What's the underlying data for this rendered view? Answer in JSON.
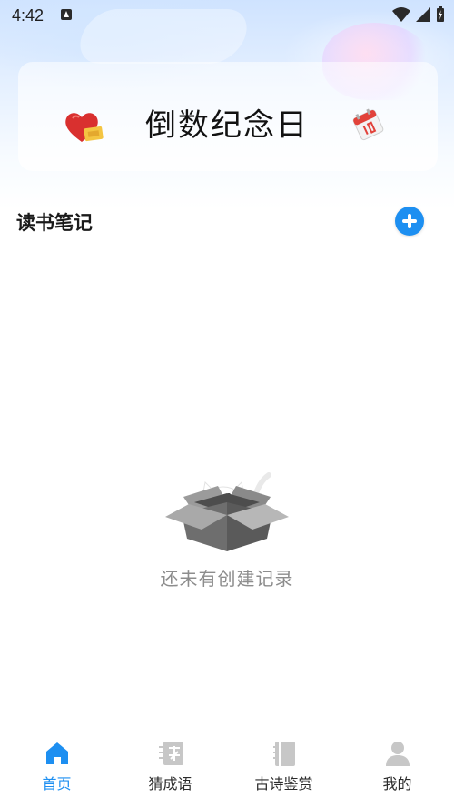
{
  "status_bar": {
    "time": "4:42",
    "icons": [
      "app-notification-icon",
      "wifi-icon",
      "signal-icon",
      "battery-charging-icon"
    ]
  },
  "banner": {
    "title": "倒数纪念日",
    "left_icon": "heart-gift-icon",
    "right_icon": "calendar-icon"
  },
  "section": {
    "title": "读书笔记",
    "add_icon": "add-icon"
  },
  "empty_state": {
    "illustration": "cat-in-box-icon",
    "message": "还未有创建记录"
  },
  "bottom_nav": {
    "items": [
      {
        "label": "首页",
        "icon": "home-icon",
        "active": true
      },
      {
        "label": "猜成语",
        "icon": "idiom-icon",
        "active": false
      },
      {
        "label": "古诗鉴赏",
        "icon": "book-icon",
        "active": false
      },
      {
        "label": "我的",
        "icon": "person-icon",
        "active": false
      }
    ]
  },
  "colors": {
    "accent": "#1d8ff1",
    "inactive_icon": "#c7c7c7",
    "empty_text": "#8d8d8d"
  }
}
